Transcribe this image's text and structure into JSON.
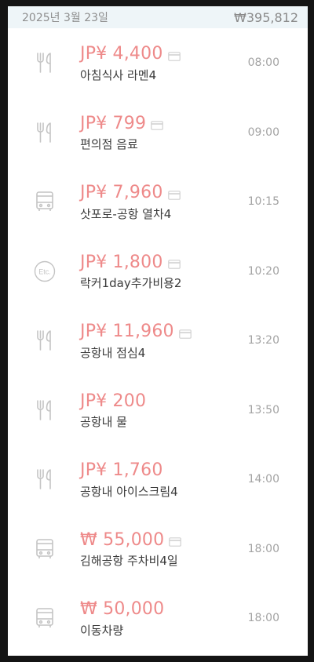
{
  "day": {
    "date": "2025년 3월 23일",
    "total": "₩395,812"
  },
  "expenses": [
    {
      "icon": "fork-knife-icon",
      "amount": "JP¥ 4,400",
      "card": true,
      "memo": "아침식사 라멘4",
      "time": "08:00"
    },
    {
      "icon": "fork-knife-icon",
      "amount": "JP¥ 799",
      "card": true,
      "memo": "편의점 음료",
      "time": "09:00"
    },
    {
      "icon": "bus-icon",
      "amount": "JP¥ 7,960",
      "card": true,
      "memo": "삿포로-공항 열차4",
      "time": "10:15"
    },
    {
      "icon": "etc-icon",
      "amount": "JP¥ 1,800",
      "card": true,
      "memo": "락커1day추가비용2",
      "time": "10:20"
    },
    {
      "icon": "fork-knife-icon",
      "amount": "JP¥ 11,960",
      "card": true,
      "memo": "공항내 점심4",
      "time": "13:20"
    },
    {
      "icon": "fork-knife-icon",
      "amount": "JP¥ 200",
      "card": false,
      "memo": "공항내 물",
      "time": "13:50"
    },
    {
      "icon": "fork-knife-icon",
      "amount": "JP¥ 1,760",
      "card": false,
      "memo": "공항내 아이스크림4",
      "time": "14:00"
    },
    {
      "icon": "bus-icon",
      "amount": "₩ 55,000",
      "card": true,
      "memo": "김해공항 주차비4일",
      "time": "18:00"
    },
    {
      "icon": "bus-icon",
      "amount": "₩ 50,000",
      "card": false,
      "memo": "이동차량",
      "time": "18:00"
    }
  ],
  "colors": {
    "amount": "#ee8a8a",
    "header_bg": "#eef5f8",
    "icon": "#c4c4c4"
  }
}
